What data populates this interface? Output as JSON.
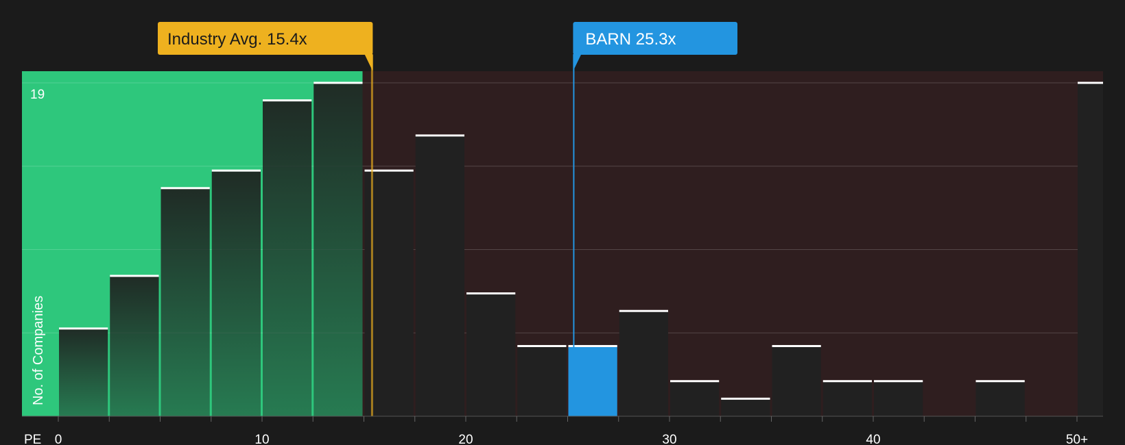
{
  "chart_data": {
    "type": "bar",
    "x_axis_title": "PE",
    "ylabel": "No. of Companies",
    "ytick_max_label": "19",
    "ylim": [
      0,
      19
    ],
    "xlim": [
      0,
      51
    ],
    "x_ticks": [
      {
        "value": 0,
        "label": "0"
      },
      {
        "value": 10,
        "label": "10"
      },
      {
        "value": 20,
        "label": "20"
      },
      {
        "value": 30,
        "label": "30"
      },
      {
        "value": 40,
        "label": "40"
      },
      {
        "value": 50,
        "label": "50+"
      }
    ],
    "bins": [
      {
        "start": 0.0,
        "end": 2.5,
        "count": 5
      },
      {
        "start": 2.5,
        "end": 5.0,
        "count": 8
      },
      {
        "start": 5.0,
        "end": 7.5,
        "count": 13
      },
      {
        "start": 7.5,
        "end": 10.0,
        "count": 14
      },
      {
        "start": 10.0,
        "end": 12.5,
        "count": 18
      },
      {
        "start": 12.5,
        "end": 15.0,
        "count": 19
      },
      {
        "start": 15.0,
        "end": 17.5,
        "count": 14
      },
      {
        "start": 17.5,
        "end": 20.0,
        "count": 16
      },
      {
        "start": 20.0,
        "end": 22.5,
        "count": 7
      },
      {
        "start": 22.5,
        "end": 25.0,
        "count": 4
      },
      {
        "start": 25.0,
        "end": 27.5,
        "count": 4,
        "highlight": true
      },
      {
        "start": 27.5,
        "end": 30.0,
        "count": 6
      },
      {
        "start": 30.0,
        "end": 32.5,
        "count": 2
      },
      {
        "start": 32.5,
        "end": 35.0,
        "count": 1
      },
      {
        "start": 35.0,
        "end": 37.5,
        "count": 4
      },
      {
        "start": 37.5,
        "end": 40.0,
        "count": 2
      },
      {
        "start": 40.0,
        "end": 42.5,
        "count": 2
      },
      {
        "start": 42.5,
        "end": 45.0,
        "count": 0
      },
      {
        "start": 45.0,
        "end": 47.5,
        "count": 2
      },
      {
        "start": 47.5,
        "end": 50.0,
        "count": 0
      },
      {
        "start": 50.0,
        "end": 51.0,
        "count": 19
      }
    ],
    "grid": true,
    "industry_avg": {
      "value": 15.4,
      "label": "Industry Avg. 15.4x",
      "color": "#eeb11f"
    },
    "company": {
      "value": 25.3,
      "label": "BARN 25.3x",
      "color": "#2395e0"
    },
    "colors": {
      "background": "#1b1b1b",
      "good_zone": "#2ec77c",
      "bad_zone": "#2f1e1f",
      "bar": "#212121",
      "highlight_bar": "#2395e0",
      "bar_cap": "#ffffff"
    }
  }
}
